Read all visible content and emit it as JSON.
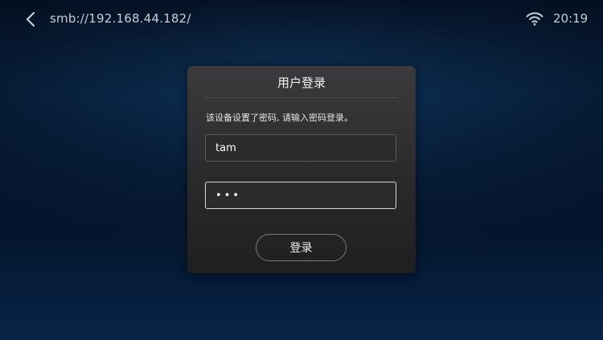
{
  "header": {
    "path": "smb://192.168.44.182/",
    "time": "20:19",
    "back_icon": "chevron-left-icon",
    "wifi_icon": "wifi-icon"
  },
  "dialog": {
    "title": "用户登录",
    "message": "该设备设置了密码, 请输入密码登录。",
    "username_value": "tam",
    "password_value": "•••",
    "login_label": "登录"
  },
  "colors": {
    "background": "#061a34",
    "dialog": "#2e2e30",
    "text_secondary": "#c9ced6",
    "focused_border": "#d8d8d8"
  }
}
